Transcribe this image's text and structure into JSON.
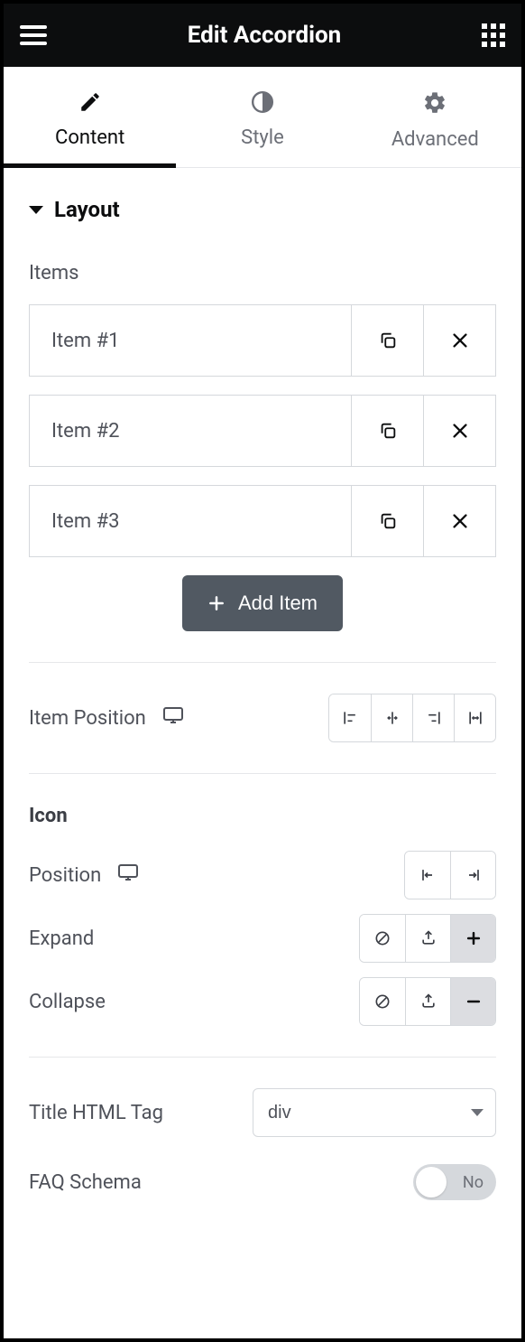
{
  "header": {
    "title": "Edit Accordion"
  },
  "tabs": {
    "content": "Content",
    "style": "Style",
    "advanced": "Advanced"
  },
  "section": {
    "layout": "Layout"
  },
  "items_label": "Items",
  "items": [
    {
      "label": "Item #1"
    },
    {
      "label": "Item #2"
    },
    {
      "label": "Item #3"
    }
  ],
  "add_item": "Add Item",
  "controls": {
    "item_position": "Item Position",
    "icon_heading": "Icon",
    "position": "Position",
    "expand": "Expand",
    "collapse": "Collapse",
    "title_html_tag": "Title HTML Tag",
    "title_tag_value": "div",
    "faq_schema": "FAQ Schema",
    "faq_value": "No"
  }
}
